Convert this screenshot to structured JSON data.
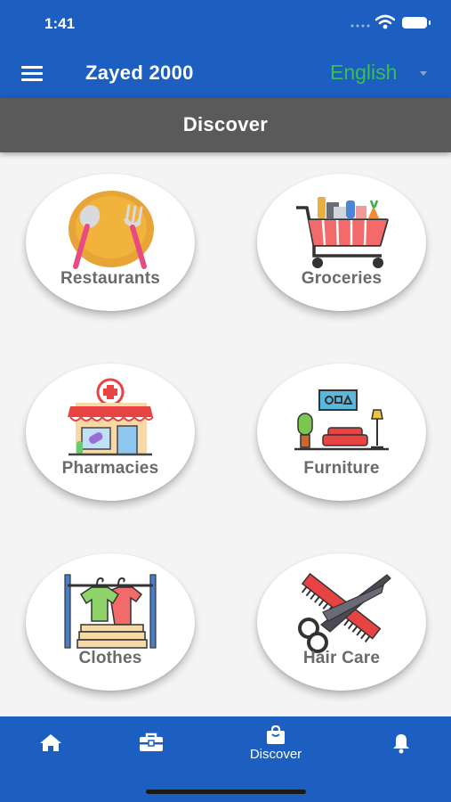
{
  "status_bar": {
    "time": "1:41"
  },
  "app_bar": {
    "title": "Zayed 2000",
    "language": "English",
    "menu_icon": "hamburger-menu-icon"
  },
  "section": {
    "title": "Discover"
  },
  "categories": [
    {
      "label": "Restaurants",
      "icon": "restaurant-plate-icon"
    },
    {
      "label": "Groceries",
      "icon": "shopping-cart-icon"
    },
    {
      "label": "Pharmacies",
      "icon": "pharmacy-store-icon"
    },
    {
      "label": "Furniture",
      "icon": "living-room-icon"
    },
    {
      "label": "Clothes",
      "icon": "clothes-rack-icon"
    },
    {
      "label": "Hair Care",
      "icon": "scissors-comb-icon"
    }
  ],
  "bottom_nav": {
    "items": [
      {
        "icon": "home-icon",
        "label": ""
      },
      {
        "icon": "toolbox-icon",
        "label": ""
      },
      {
        "icon": "shopping-bag-icon",
        "label": "Discover",
        "active": true
      },
      {
        "icon": "bell-icon",
        "label": ""
      }
    ]
  },
  "colors": {
    "primary": "#1c5fc0",
    "header_gray": "#5a5a5a",
    "language_green": "#38c14b",
    "label_gray": "#6a6a6a"
  }
}
